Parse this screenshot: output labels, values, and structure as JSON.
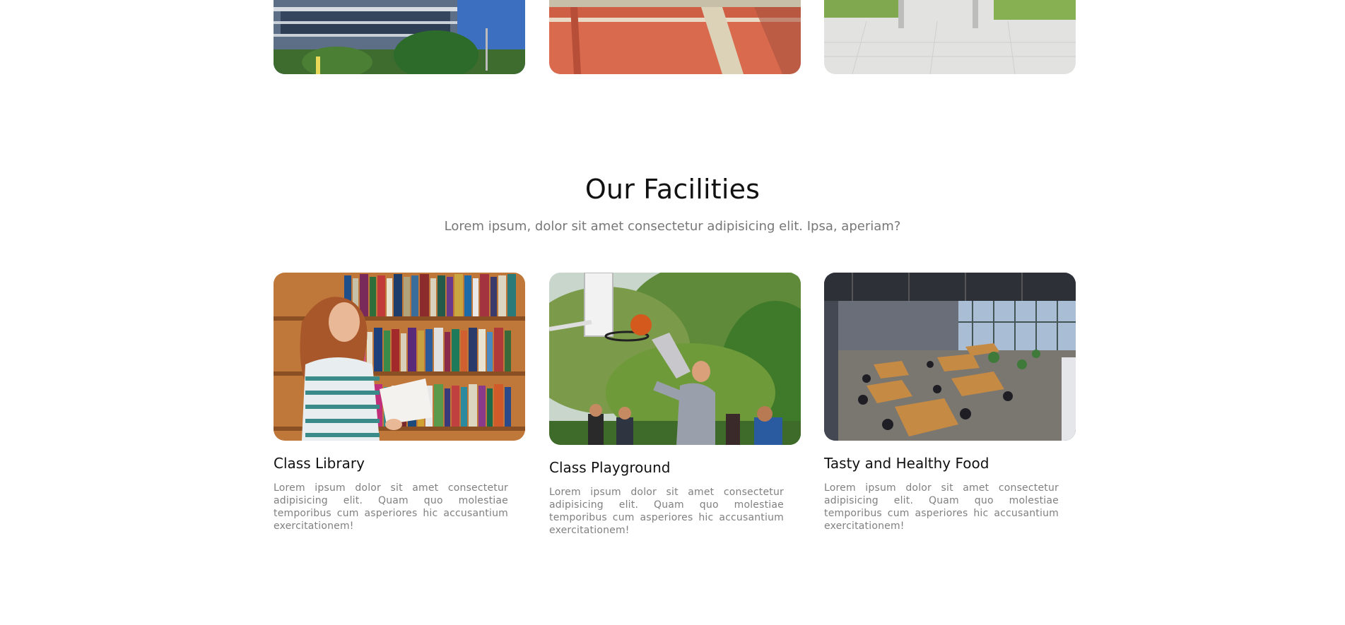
{
  "facilities": {
    "title": "Our Facilities",
    "subtitle": "Lorem ipsum, dolor sit amet consectetur adipisicing elit. Ipsa, aperiam?",
    "items": [
      {
        "title": "Class Library",
        "description": "Lorem ipsum dolor sit amet consectetur adipisicing elit. Quam quo molestiae temporibus cum asperiores hic accusantium exercitationem!"
      },
      {
        "title": "Class Playground",
        "description": "Lorem ipsum dolor sit amet consectetur adipisicing elit. Quam quo molestiae temporibus cum asperiores hic accusantium exercitationem!"
      },
      {
        "title": "Tasty and Healthy Food",
        "description": "Lorem ipsum dolor sit amet consectetur adipisicing elit. Quam quo molestiae temporibus cum asperiores hic accusantium exercitationem!"
      }
    ]
  }
}
